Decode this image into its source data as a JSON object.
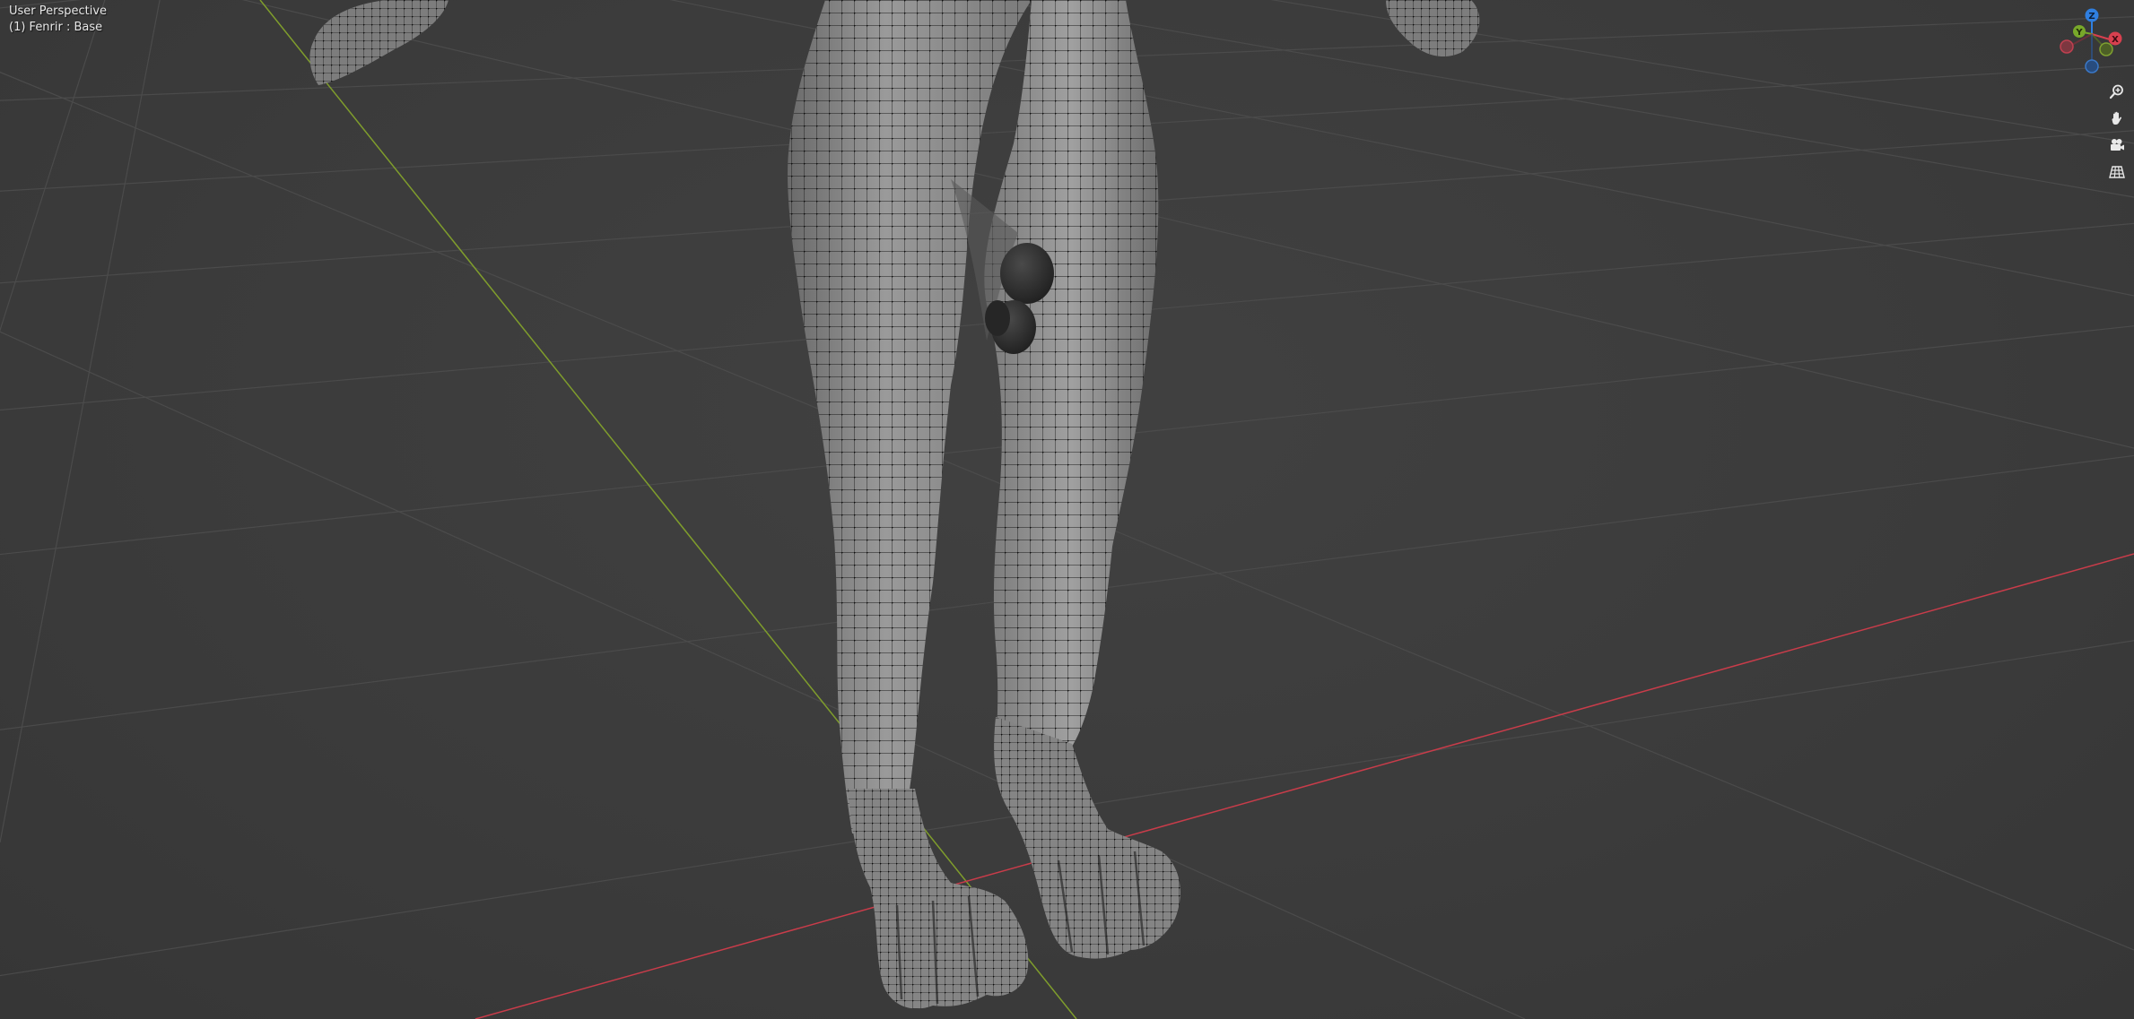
{
  "viewport": {
    "view_mode": "User Perspective",
    "active_object": "(1) Fenrir : Base"
  },
  "gizmo": {
    "axes": [
      {
        "name": "z",
        "label": "Z",
        "color": "#2f7fe0"
      },
      {
        "name": "y",
        "label": "Y",
        "color": "#78a82a"
      },
      {
        "name": "x",
        "label": "X",
        "color": "#d8404f"
      }
    ]
  },
  "nav_buttons": [
    {
      "name": "zoom",
      "icon": "magnifier-icon"
    },
    {
      "name": "pan",
      "icon": "hand-icon"
    },
    {
      "name": "camera",
      "icon": "camera-icon"
    },
    {
      "name": "ortho",
      "icon": "grid-icon"
    }
  ],
  "colors": {
    "background": "#3d3d3d",
    "grid_line": "#4a4a4a",
    "x_axis": "#d0414e",
    "y_axis": "#7f9d2c",
    "mesh_fill": "#8a8a8a",
    "mesh_wire": "#1a1a1a"
  }
}
